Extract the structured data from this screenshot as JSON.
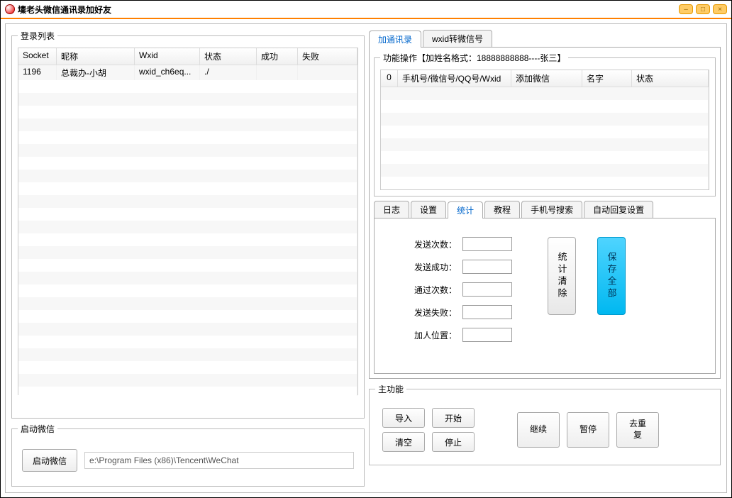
{
  "window": {
    "title": "壈老头微信通讯录加好友"
  },
  "login": {
    "legend": "登录列表",
    "columns": {
      "socket": "Socket",
      "nick": "昵称",
      "wxid": "Wxid",
      "status": "状态",
      "success": "成功",
      "fail": "失败"
    },
    "rows": [
      {
        "socket": "1196",
        "nick": "总裁办-小胡",
        "wxid": "wxid_ch6eq...",
        "status": "./",
        "success": "",
        "fail": ""
      }
    ]
  },
  "launch": {
    "legend": "启动微信",
    "button": "启动微信",
    "path": "e:\\Program Files (x86)\\Tencent\\WeChat"
  },
  "topTabs": {
    "add": "加通讯录",
    "convert": "wxid转微信号"
  },
  "ops": {
    "legend": "功能操作【加姓名格式：18888888888----张三】",
    "columns": {
      "idx": "0",
      "id": "手机号/微信号/QQ号/Wxid",
      "add": "添加微信",
      "name": "名字",
      "status": "状态"
    }
  },
  "subTabs": {
    "log": "日志",
    "setting": "设置",
    "stats": "统计",
    "tutorial": "教程",
    "phone": "手机号搜索",
    "autoreply": "自动回复设置"
  },
  "stats": {
    "sendCount": {
      "label": "发送次数：",
      "value": ""
    },
    "sendSuccess": {
      "label": "发送成功：",
      "value": ""
    },
    "passCount": {
      "label": "通过次数：",
      "value": ""
    },
    "sendFail": {
      "label": "发送失败：",
      "value": ""
    },
    "addPos": {
      "label": "加人位置：",
      "value": ""
    },
    "clearBtn": "统计清除",
    "saveBtn": "保存全部"
  },
  "mainFunc": {
    "legend": "主功能",
    "import": "导入",
    "start": "开始",
    "clear": "清空",
    "stop": "停止",
    "continue": "继续",
    "pause": "暂停",
    "dedupe": "去重复"
  }
}
